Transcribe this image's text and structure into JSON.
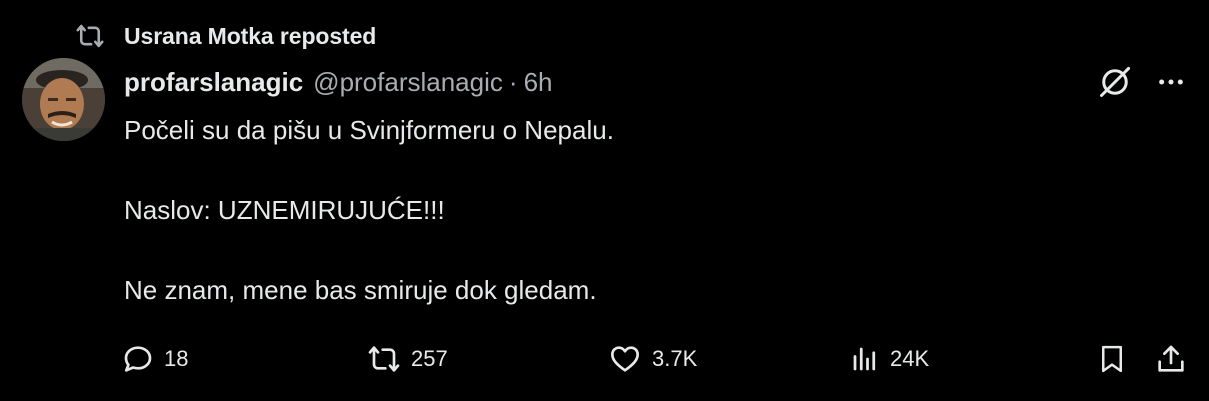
{
  "repost": {
    "text": "Usrana Motka reposted",
    "icon": "repost-icon"
  },
  "author": {
    "name": "profarslanagic",
    "handle": "@profarslanagic",
    "separator": "·",
    "time": "6h"
  },
  "post": {
    "lines": [
      "Počeli su da pišu u Svinjformeru o Nepalu.",
      "Naslov: UZNEMIRUJUĆE!!!",
      "Ne znam, mene bas smiruje dok gledam."
    ]
  },
  "actions": {
    "replies": "18",
    "reposts": "257",
    "likes": "3.7K",
    "views": "24K"
  },
  "icons": {
    "grok": "grok-icon",
    "more": "more-icon",
    "reply": "reply-icon",
    "repost": "repost-icon",
    "like": "heart-icon",
    "views": "views-icon",
    "bookmark": "bookmark-icon",
    "share": "share-icon"
  },
  "colors": {
    "background": "#000000",
    "text": "#e7e9ea",
    "secondary": "#a9adb1"
  }
}
